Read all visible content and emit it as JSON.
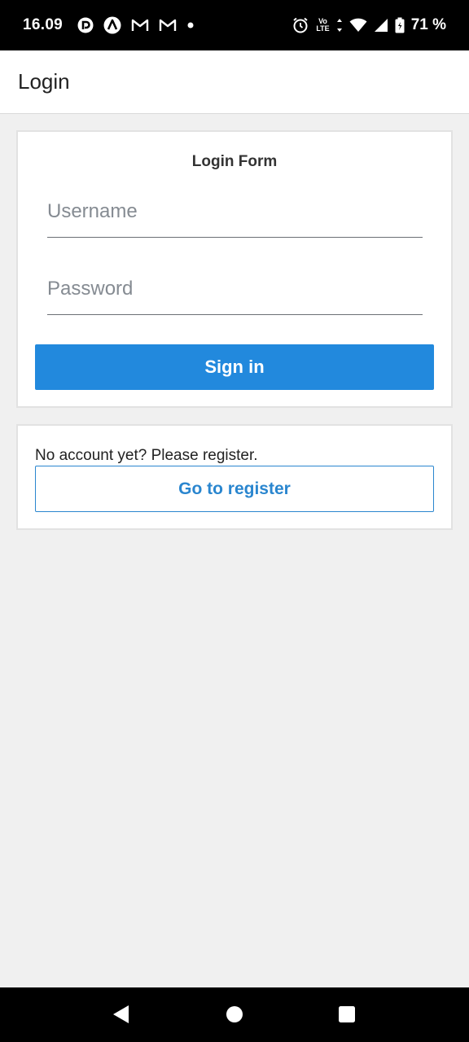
{
  "status_bar": {
    "time": "16.09",
    "notification_icons": [
      "pocket-casts-icon",
      "arc-icon",
      "gmail-icon",
      "gmail-icon",
      "dot-icon"
    ],
    "system_icons": [
      "alarm-icon",
      "volte-icon",
      "data-arrows-icon",
      "wifi-icon",
      "signal-icon",
      "battery-icon"
    ],
    "volte_top": "Vo",
    "volte_bottom": "LTE",
    "battery_percent": "71 %"
  },
  "app_bar": {
    "title": "Login"
  },
  "login_form": {
    "title": "Login Form",
    "username": {
      "value": "",
      "placeholder": "Username"
    },
    "password": {
      "value": "",
      "placeholder": "Password"
    },
    "sign_in_label": "Sign in"
  },
  "register": {
    "prompt": "No account yet? Please register.",
    "button_label": "Go to register"
  },
  "nav_bar": {
    "buttons": [
      "back-icon",
      "home-icon",
      "recents-icon"
    ]
  },
  "colors": {
    "primary": "#2289dd",
    "outline_button": "#2a86cf",
    "background": "#f0f0f0"
  }
}
